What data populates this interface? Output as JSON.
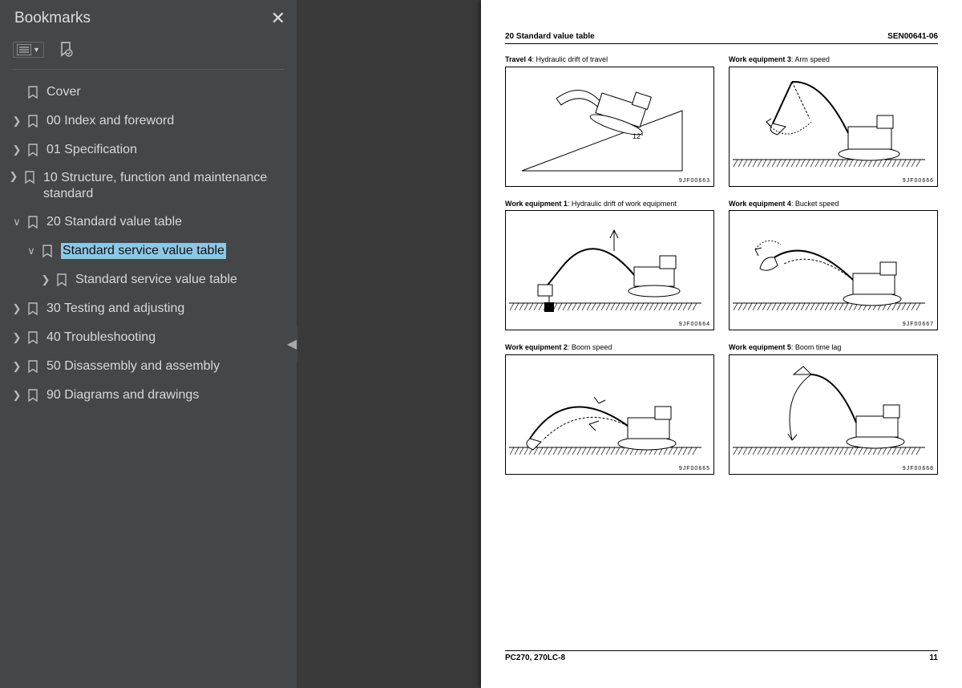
{
  "sidebar": {
    "title": "Bookmarks",
    "items": [
      {
        "caret": "",
        "label": "Cover",
        "indent": 0
      },
      {
        "caret": ">",
        "label": "00 Index and foreword",
        "indent": 0
      },
      {
        "caret": ">",
        "label": "01 Specification",
        "indent": 0
      },
      {
        "caret": ">",
        "label": "10 Structure, function and maintenance standard",
        "indent": 0,
        "wrap": true
      },
      {
        "caret": "v",
        "label": "20 Standard value table",
        "indent": 0
      },
      {
        "caret": "v",
        "label": "Standard service value table",
        "indent": 1,
        "selected": true
      },
      {
        "caret": ">",
        "label": "Standard service value table",
        "indent": 2
      },
      {
        "caret": ">",
        "label": "30 Testing and adjusting",
        "indent": 0
      },
      {
        "caret": ">",
        "label": "40 Troubleshooting",
        "indent": 0
      },
      {
        "caret": ">",
        "label": "50 Disassembly and assembly",
        "indent": 0
      },
      {
        "caret": ">",
        "label": "90 Diagrams and drawings",
        "indent": 0
      }
    ]
  },
  "page": {
    "header_left": "20 Standard value table",
    "header_right": "SEN00641-06",
    "footer_left": "PC270, 270LC-8",
    "footer_right": "11",
    "left_col": [
      {
        "bold": "Travel 4",
        "rest": ": Hydraulic drift of travel",
        "code": "9JF00663"
      },
      {
        "bold": "Work equipment 1",
        "rest": ": Hydraulic drift of work equipment",
        "code": "9JF00664"
      },
      {
        "bold": "Work equipment 2",
        "rest": ": Boom speed",
        "code": "9JF00665"
      }
    ],
    "right_col": [
      {
        "bold": "Work equipment 3",
        "rest": ": Arm speed",
        "code": "9JF00666"
      },
      {
        "bold": "Work equipment 4",
        "rest": ": Bucket speed",
        "code": "9JF00667"
      },
      {
        "bold": "Work equipment 5",
        "rest": ": Boom time lag",
        "code": "9JF00668"
      }
    ],
    "slope_angle": "12°"
  }
}
